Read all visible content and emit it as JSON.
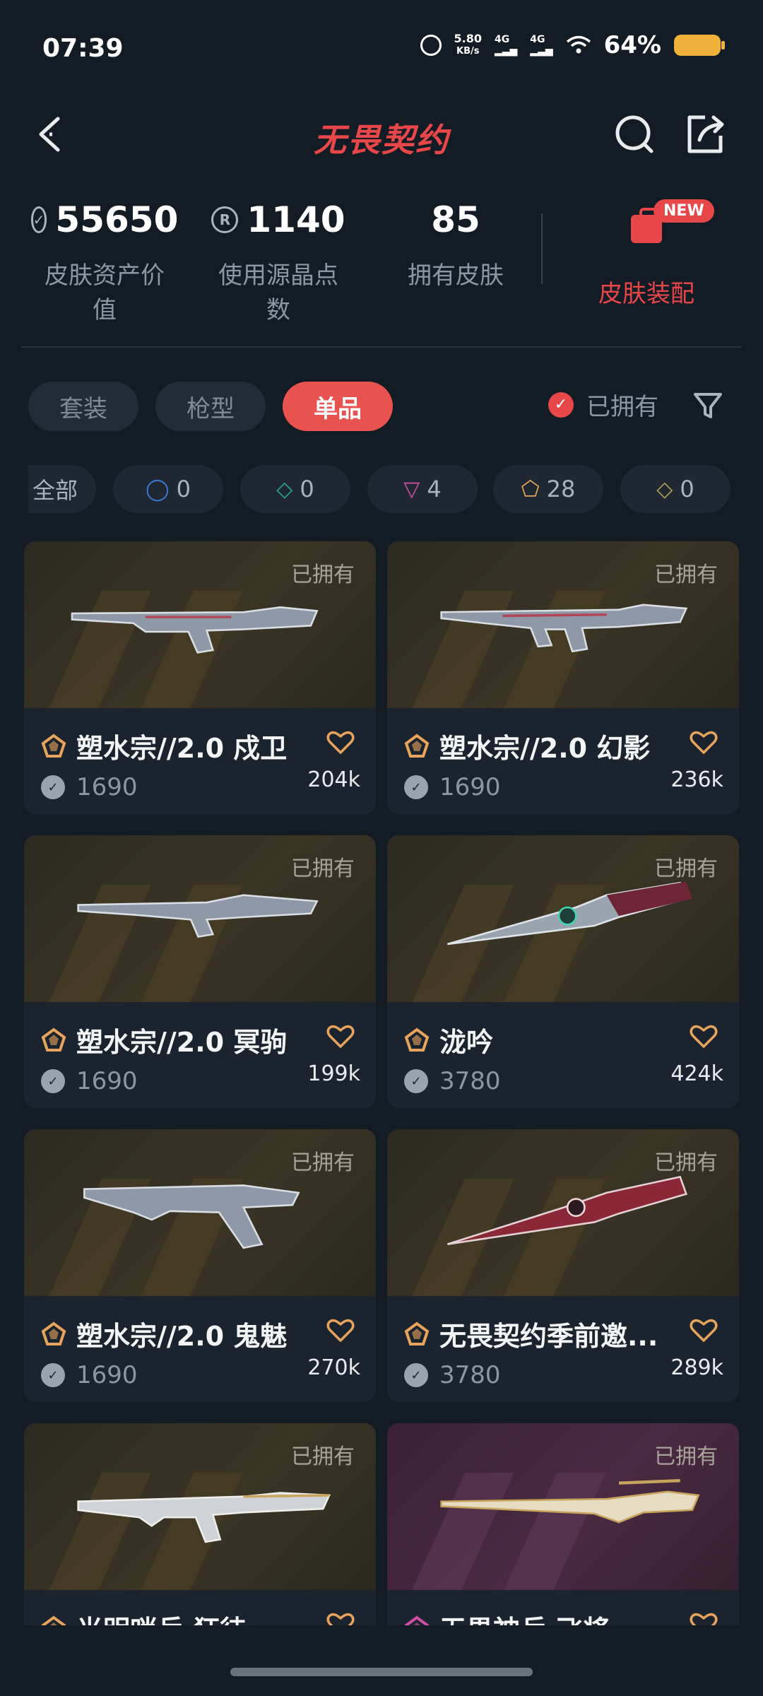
{
  "status_bar": {
    "time": "07:39",
    "net_speed": "5.80",
    "net_unit": "KB/s",
    "sig1": "4G",
    "sig2": "4G",
    "battery": "64%"
  },
  "header": {
    "title": "无畏契约",
    "back_icon": "chevron-left-icon",
    "search_icon": "search-icon",
    "share_icon": "share-icon"
  },
  "stats": {
    "asset_value": "55650",
    "asset_label": "皮肤资产价值",
    "points_value": "1140",
    "points_label": "使用源晶点数",
    "skins_value": "85",
    "skins_label": "拥有皮肤",
    "equip_label": "皮肤装配",
    "new_badge": "NEW"
  },
  "tabs": [
    {
      "label": "套装",
      "active": false
    },
    {
      "label": "枪型",
      "active": false
    },
    {
      "label": "单品",
      "active": true
    }
  ],
  "owned_filter": {
    "label": "已拥有",
    "checked": true
  },
  "tiers": [
    {
      "label": "全部",
      "count": ""
    },
    {
      "symbol": "◯",
      "count": "0",
      "color": "#3b7bd6"
    },
    {
      "symbol": "◇",
      "count": "0",
      "color": "#2aa58a"
    },
    {
      "symbol": "▽",
      "count": "4",
      "color": "#d24fa8"
    },
    {
      "symbol": "⬠",
      "count": "28",
      "color": "#e8a35c"
    },
    {
      "symbol": "◇",
      "count": "0",
      "color": "#b4a05a"
    }
  ],
  "cards": [
    {
      "owned": "已拥有",
      "name": "塑水宗//2.0 戍卫",
      "price": "1690",
      "likes": "204k",
      "tier_color": "#e8a35c"
    },
    {
      "owned": "已拥有",
      "name": "塑水宗//2.0 幻影",
      "price": "1690",
      "likes": "236k",
      "tier_color": "#e8a35c"
    },
    {
      "owned": "已拥有",
      "name": "塑水宗//2.0 冥驹",
      "price": "1690",
      "likes": "199k",
      "tier_color": "#e8a35c"
    },
    {
      "owned": "已拥有",
      "name": "泷吟",
      "price": "3780",
      "likes": "424k",
      "tier_color": "#e8a35c"
    },
    {
      "owned": "已拥有",
      "name": "塑水宗//2.0 鬼魅",
      "price": "1690",
      "likes": "270k",
      "tier_color": "#e8a35c"
    },
    {
      "owned": "已拥有",
      "name": "无畏契约季前邀...",
      "price": "3780",
      "likes": "289k",
      "tier_color": "#e8a35c"
    },
    {
      "owned": "已拥有",
      "name": "光明哨兵 狂徒",
      "price": "",
      "likes": "",
      "tier_color": "#e8a35c"
    },
    {
      "owned": "已拥有",
      "name": "无畏神兵 飞将",
      "price": "",
      "likes": "",
      "tier_color": "#d24fa8"
    }
  ]
}
